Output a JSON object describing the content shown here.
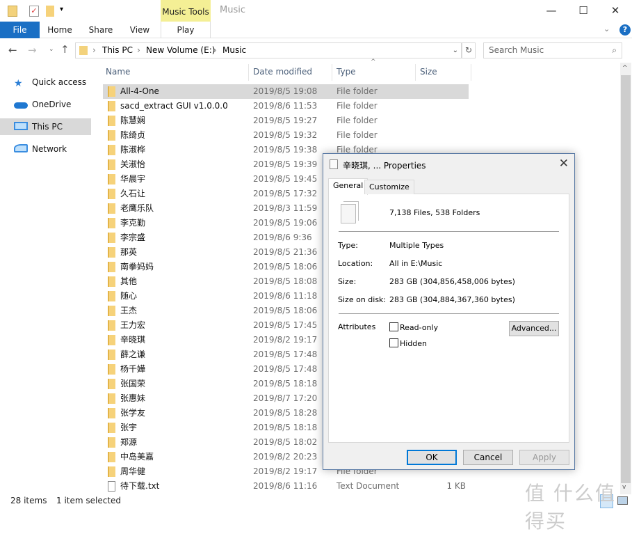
{
  "window": {
    "title": "Music",
    "context_tab_group": "Music Tools",
    "minimize": "—",
    "maximize": "☐",
    "close": "✕"
  },
  "ribbon": {
    "tabs": [
      "File",
      "Home",
      "Share",
      "View",
      "Play"
    ],
    "help": "?"
  },
  "address": {
    "crumbs": [
      "This PC",
      "New Volume (E:)",
      "Music"
    ],
    "search_placeholder": "Search Music"
  },
  "sidebar": {
    "items": [
      {
        "label": "Quick access",
        "icon": "star-icon"
      },
      {
        "label": "OneDrive",
        "icon": "cloud-icon"
      },
      {
        "label": "This PC",
        "icon": "computer-icon",
        "selected": true
      },
      {
        "label": "Network",
        "icon": "network-icon"
      }
    ]
  },
  "columns": [
    "Name",
    "Date modified",
    "Type",
    "Size"
  ],
  "files": [
    {
      "name": "All-4-One",
      "date": "2019/8/5 19:08",
      "type": "File folder",
      "size": ""
    },
    {
      "name": "sacd_extract GUI v1.0.0.0",
      "date": "2019/8/6 11:53",
      "type": "File folder",
      "size": ""
    },
    {
      "name": "陈慧娴",
      "date": "2019/8/5 19:27",
      "type": "File folder",
      "size": ""
    },
    {
      "name": "陈绮贞",
      "date": "2019/8/5 19:32",
      "type": "File folder",
      "size": ""
    },
    {
      "name": "陈淑桦",
      "date": "2019/8/5 19:38",
      "type": "File folder",
      "size": ""
    },
    {
      "name": "关淑怡",
      "date": "2019/8/5 19:39",
      "type": "File folder",
      "size": ""
    },
    {
      "name": "华晨宇",
      "date": "2019/8/5 19:45",
      "type": "File folder",
      "size": ""
    },
    {
      "name": "久石让",
      "date": "2019/8/5 17:32",
      "type": "File folder",
      "size": ""
    },
    {
      "name": "老鹰乐队",
      "date": "2019/8/3 11:59",
      "type": "File folder",
      "size": ""
    },
    {
      "name": "李克勤",
      "date": "2019/8/5 19:06",
      "type": "File folder",
      "size": ""
    },
    {
      "name": "李宗盛",
      "date": "2019/8/6 9:36",
      "type": "File folder",
      "size": ""
    },
    {
      "name": "那英",
      "date": "2019/8/5 21:36",
      "type": "File folder",
      "size": ""
    },
    {
      "name": "南拳妈妈",
      "date": "2019/8/5 18:06",
      "type": "File folder",
      "size": ""
    },
    {
      "name": "其他",
      "date": "2019/8/5 18:08",
      "type": "File folder",
      "size": ""
    },
    {
      "name": "随心",
      "date": "2019/8/6 11:18",
      "type": "File folder",
      "size": ""
    },
    {
      "name": "王杰",
      "date": "2019/8/5 18:06",
      "type": "File folder",
      "size": ""
    },
    {
      "name": "王力宏",
      "date": "2019/8/5 17:45",
      "type": "File folder",
      "size": ""
    },
    {
      "name": "辛晓琪",
      "date": "2019/8/2 19:17",
      "type": "File folder",
      "size": ""
    },
    {
      "name": "薛之谦",
      "date": "2019/8/5 17:48",
      "type": "File folder",
      "size": ""
    },
    {
      "name": "杨千嬅",
      "date": "2019/8/5 17:48",
      "type": "File folder",
      "size": ""
    },
    {
      "name": "张国荣",
      "date": "2019/8/5 18:18",
      "type": "File folder",
      "size": ""
    },
    {
      "name": "张惠妹",
      "date": "2019/8/7 17:20",
      "type": "File folder",
      "size": ""
    },
    {
      "name": "张学友",
      "date": "2019/8/5 18:28",
      "type": "File folder",
      "size": ""
    },
    {
      "name": "张宇",
      "date": "2019/8/5 18:18",
      "type": "File folder",
      "size": ""
    },
    {
      "name": "郑源",
      "date": "2019/8/5 18:02",
      "type": "File folder",
      "size": ""
    },
    {
      "name": "中岛美嘉",
      "date": "2019/8/2 20:23",
      "type": "File folder",
      "size": ""
    },
    {
      "name": "周华健",
      "date": "2019/8/2 19:17",
      "type": "File folder",
      "size": ""
    },
    {
      "name": "待下载.txt",
      "date": "2019/8/6 11:16",
      "type": "Text Document",
      "size": "1 KB",
      "is_text": true
    }
  ],
  "status": {
    "items": "28 items",
    "selected": "1 item selected"
  },
  "dialog": {
    "title": "辛晓琪, ... Properties",
    "tabs": [
      "General",
      "Customize"
    ],
    "summary": "7,138 Files, 538 Folders",
    "props": [
      {
        "label": "Type:",
        "value": "Multiple Types"
      },
      {
        "label": "Location:",
        "value": "All in E:\\Music"
      },
      {
        "label": "Size:",
        "value": "283 GB (304,856,458,006 bytes)"
      },
      {
        "label": "Size on disk:",
        "value": "283 GB (304,884,367,360 bytes)"
      }
    ],
    "attributes_label": "Attributes",
    "readonly": "Read-only",
    "hidden": "Hidden",
    "advanced": "Advanced...",
    "ok": "OK",
    "cancel": "Cancel",
    "apply": "Apply",
    "close": "✕"
  },
  "watermark": "值 什么值得买",
  "colors": {
    "file_tab": "#1a6fc4",
    "context_tab": "#f4ef95",
    "selection": "#d9d9d9",
    "default_button": "#0078d7"
  }
}
